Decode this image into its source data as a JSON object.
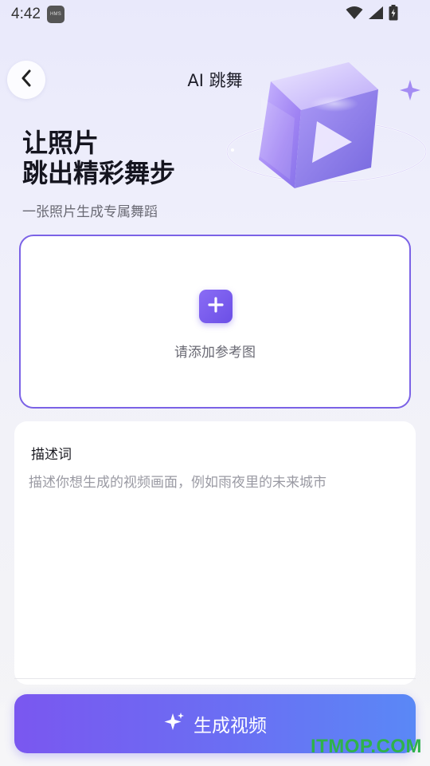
{
  "status_bar": {
    "time": "4:42",
    "badge": "HMS",
    "icons": [
      "wifi-icon",
      "signal-icon",
      "battery-charging-icon"
    ]
  },
  "header": {
    "back_icon": "chevron-left-icon",
    "title": "AI 跳舞"
  },
  "hero": {
    "headline_line1": "让照片",
    "headline_line2": "跳出精彩舞步",
    "subline": "一张照片生成专属舞蹈",
    "art_icon": "play-cube-icon"
  },
  "upload": {
    "add_icon": "plus-icon",
    "hint": "请添加参考图"
  },
  "prompt": {
    "label": "描述词",
    "value": "",
    "placeholder": "描述你想生成的视频画面，例如雨夜里的未来城市"
  },
  "action": {
    "icon": "sparkle-icon",
    "label": "生成视频"
  },
  "watermark": "ITMOP.COM",
  "colors": {
    "accent": "#7b62e6",
    "button_start": "#7a57f0",
    "button_end": "#5a88f6",
    "watermark": "#2fb24a"
  }
}
